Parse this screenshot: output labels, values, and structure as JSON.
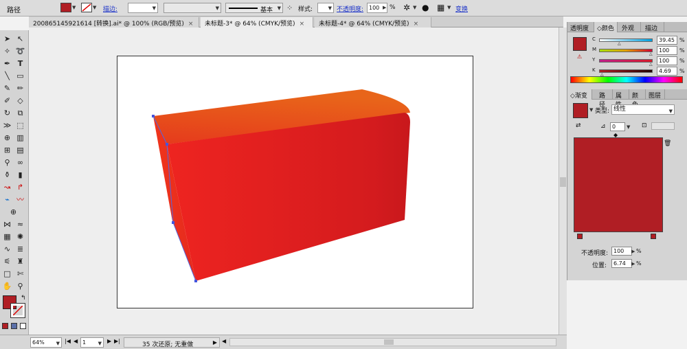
{
  "control_bar": {
    "object_type": "路径",
    "stroke_label": "描边:",
    "stroke_profile": "基本",
    "style_label": "样式:",
    "opacity_label": "不透明度:",
    "opacity_value": "100",
    "opacity_unit": "%",
    "transform_label": "变换",
    "fill_color": "#b01e24"
  },
  "tabs": [
    {
      "label": "200865145921614 [转换].ai* @ 100% (RGB/预览)"
    },
    {
      "label": "未标题-3* @ 64% (CMYK/预览)"
    },
    {
      "label": "未标题-4* @ 64% (CMYK/预览)"
    }
  ],
  "tab_close": "×",
  "status_bar": {
    "zoom": "64%",
    "page": "1",
    "history": "35 次还原; 无重做"
  },
  "color_panel": {
    "tabs": [
      "透明度",
      "颜色",
      "外观",
      "描边"
    ],
    "channels": [
      {
        "name": "C",
        "value": "39.45",
        "fraction": 0.39
      },
      {
        "name": "M",
        "value": "100",
        "fraction": 1.0
      },
      {
        "name": "Y",
        "value": "100",
        "fraction": 1.0
      },
      {
        "name": "K",
        "value": "4.69",
        "fraction": 0.05
      }
    ],
    "swatch_color": "#b01e24"
  },
  "gradient_panel": {
    "tabs": [
      "渐变",
      "路径",
      "属性",
      "颜色",
      "图层"
    ],
    "type_label": "类型:",
    "type_value": "线性",
    "angle_value": "0",
    "opacity_label": "不透明度:",
    "opacity_value": "100",
    "location_label": "位置:",
    "location_value": "6.74",
    "percent": "%",
    "gradient_color": "#b01e24"
  }
}
